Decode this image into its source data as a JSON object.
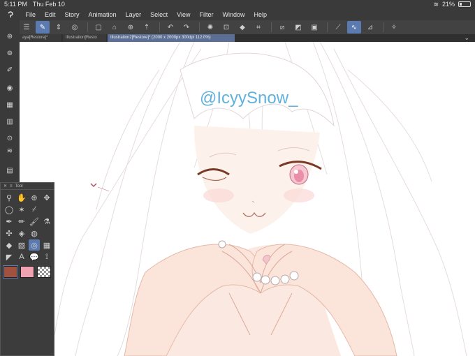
{
  "status": {
    "time": "5:11 PM",
    "date": "Thu Feb 10",
    "battery": "21%",
    "battery_level": 0.21
  },
  "menu": [
    "File",
    "Edit",
    "Story",
    "Animation",
    "Layer",
    "Select",
    "View",
    "Filter",
    "Window",
    "Help"
  ],
  "tabs": [
    {
      "label": "aya[Restore]*"
    },
    {
      "label": "Illustration[Resto"
    },
    {
      "label": "Illustration2[Restore]* (2000 x 2000px 300dpi 112.0%)"
    }
  ],
  "canvas": {
    "watermark": "@IcyySnow_"
  },
  "tool_panel": {
    "title": "Tool"
  },
  "colors": {
    "main": "#a0523f",
    "sub": "#f2a3b3",
    "accent": "#5a7ab0"
  }
}
